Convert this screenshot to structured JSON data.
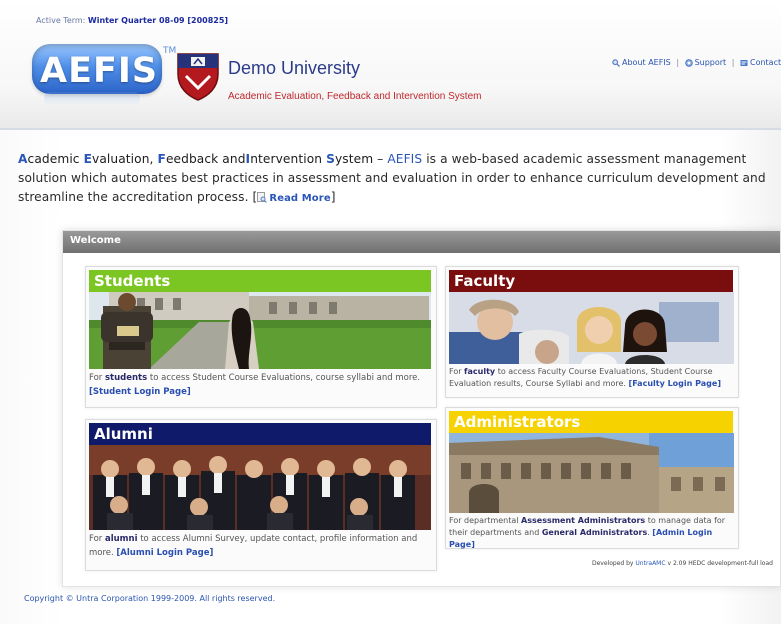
{
  "header": {
    "active_term_label": "Active Term:",
    "active_term_value": "Winter Quarter 08-09 [200825]",
    "logo_text": "AEFIS",
    "logo_tm": "TM",
    "university_name": "Demo University",
    "system_name": "Academic Evaluation, Feedback and Intervention System",
    "links": [
      "About AEFIS",
      "Support",
      "Contact Us"
    ]
  },
  "intro": {
    "a_cap": "A",
    "a_rest": "cademic ",
    "e_cap": "E",
    "e_rest": "valuation, ",
    "f_cap": "F",
    "f_rest": "eedback and",
    "i_cap": "I",
    "i_rest": "ntervention ",
    "s_cap": "S",
    "s_rest": "ystem",
    "dash": " – ",
    "aefis": "AEFIS",
    "body": " is a web-based academic assessment management solution which automates best practices in assessment and evaluation in order to enhance curriculum development and streamline the accreditation process. [",
    "read_more": "Read More",
    "close": "]"
  },
  "welcome": {
    "title": "Welcome",
    "cards": {
      "students": {
        "title": "Students",
        "desc_pre": "For ",
        "desc_bold": "students",
        "desc_post": " to access Student Course Evaluations, course syllabi and more. ",
        "link": "[Student Login Page]",
        "color": "#7cc623"
      },
      "faculty": {
        "title": "Faculty",
        "desc_pre": "For ",
        "desc_bold": "faculty",
        "desc_post": " to access Faculty Course Evaluations, Student Course Evaluation results, Course Syllabi and more. ",
        "link": "[Faculty Login Page]",
        "color": "#7a0d0d"
      },
      "alumni": {
        "title": "Alumni",
        "desc_pre": "For ",
        "desc_bold": "alumni",
        "desc_post": " to access Alumni Survey, update contact, profile information and more. ",
        "link": "[Alumni Login Page]",
        "color": "#101a6a"
      },
      "administrators": {
        "title": "Administrators",
        "desc_pre": "For departmental ",
        "desc_bold": "Assessment Administrators",
        "desc_mid": " to manage data for their departments and ",
        "desc_bold2": "General Administrators",
        "desc_post": ". ",
        "link": "[Admin Login Page]",
        "color": "#f6d200"
      }
    }
  },
  "footer": {
    "developed_by": "Developed by",
    "developer": "UntraAMC",
    "version": "v 2.09 HEDC development-full load",
    "copyright": "Copyright © Untra Corporation 1999-2009. All rights reserved."
  }
}
